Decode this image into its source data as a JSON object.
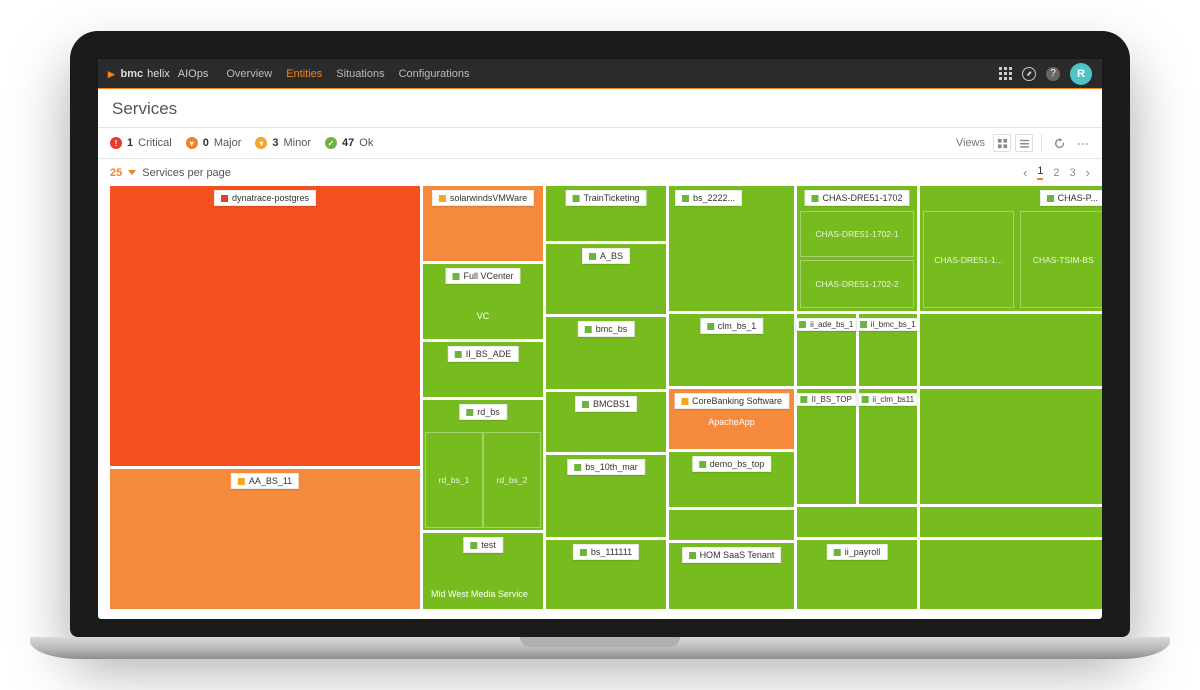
{
  "brand": {
    "company": "bmc",
    "product": "helix",
    "module": "AIOps"
  },
  "nav": {
    "overview": "Overview",
    "entities": "Entities",
    "situations": "Situations",
    "configurations": "Configurations"
  },
  "avatar_initial": "R",
  "page_title": "Services",
  "statuses": {
    "critical": {
      "count": "1",
      "label": "Critical"
    },
    "major": {
      "count": "0",
      "label": "Major"
    },
    "minor": {
      "count": "3",
      "label": "Minor"
    },
    "ok": {
      "count": "47",
      "label": "Ok"
    }
  },
  "views_label": "Views",
  "per_page": {
    "count": "25",
    "label": "Services per page"
  },
  "pager": {
    "p1": "1",
    "p2": "2",
    "p3": "3"
  },
  "tiles": {
    "dynatrace": "dynatrace-postgres",
    "aa_bs_11": "AA_BS_11",
    "solarwinds": "solarwindsVMWare",
    "full_vcenter": "Full VCenter",
    "vc_sub": "VC",
    "ii_bs_ade": "II_BS_ADE",
    "rd_bs": "rd_bs",
    "rd_bs_1": "rd_bs_1",
    "rd_bs_2": "rd_bs_2",
    "test": "test",
    "midwest": "Mid West Media Service",
    "train": "TrainTicketing",
    "a_bs": "A_BS",
    "bmc_bs": "bmc_bs",
    "bmcbs1": "BMCBS1",
    "bs_10th": "bs_10th_mar",
    "bs_111111": "bs_111111",
    "bs_2222": "bs_2222...",
    "clm_bs_1": "clm_bs_1",
    "corebank": "CoreBanking Software",
    "apacheapp": "ApacheApp",
    "demo_bs_top": "demo_bs_top",
    "hom_saas": "HOM SaaS Tenant",
    "chas_dre51": "CHAS-DRE51-1702",
    "chas_1702_1": "CHAS-DRE51-1702-1",
    "chas_1702_2": "CHAS-DRE51-1702-2",
    "chas_dre51_1": "CHAS-DRE51-1...",
    "chas_tsim": "CHAS-TSIM-BS",
    "chas_p": "CHAS-P...",
    "ii_ade_bs_1": "ii_ade_bs_1",
    "ii_bmc_bs_1": "ii_bmc_bs_1",
    "ii_bs_top": "II_BS_TOP",
    "ii_clm_bs11": "ii_clm_bs11",
    "ii_payroll": "ii_payroll"
  }
}
